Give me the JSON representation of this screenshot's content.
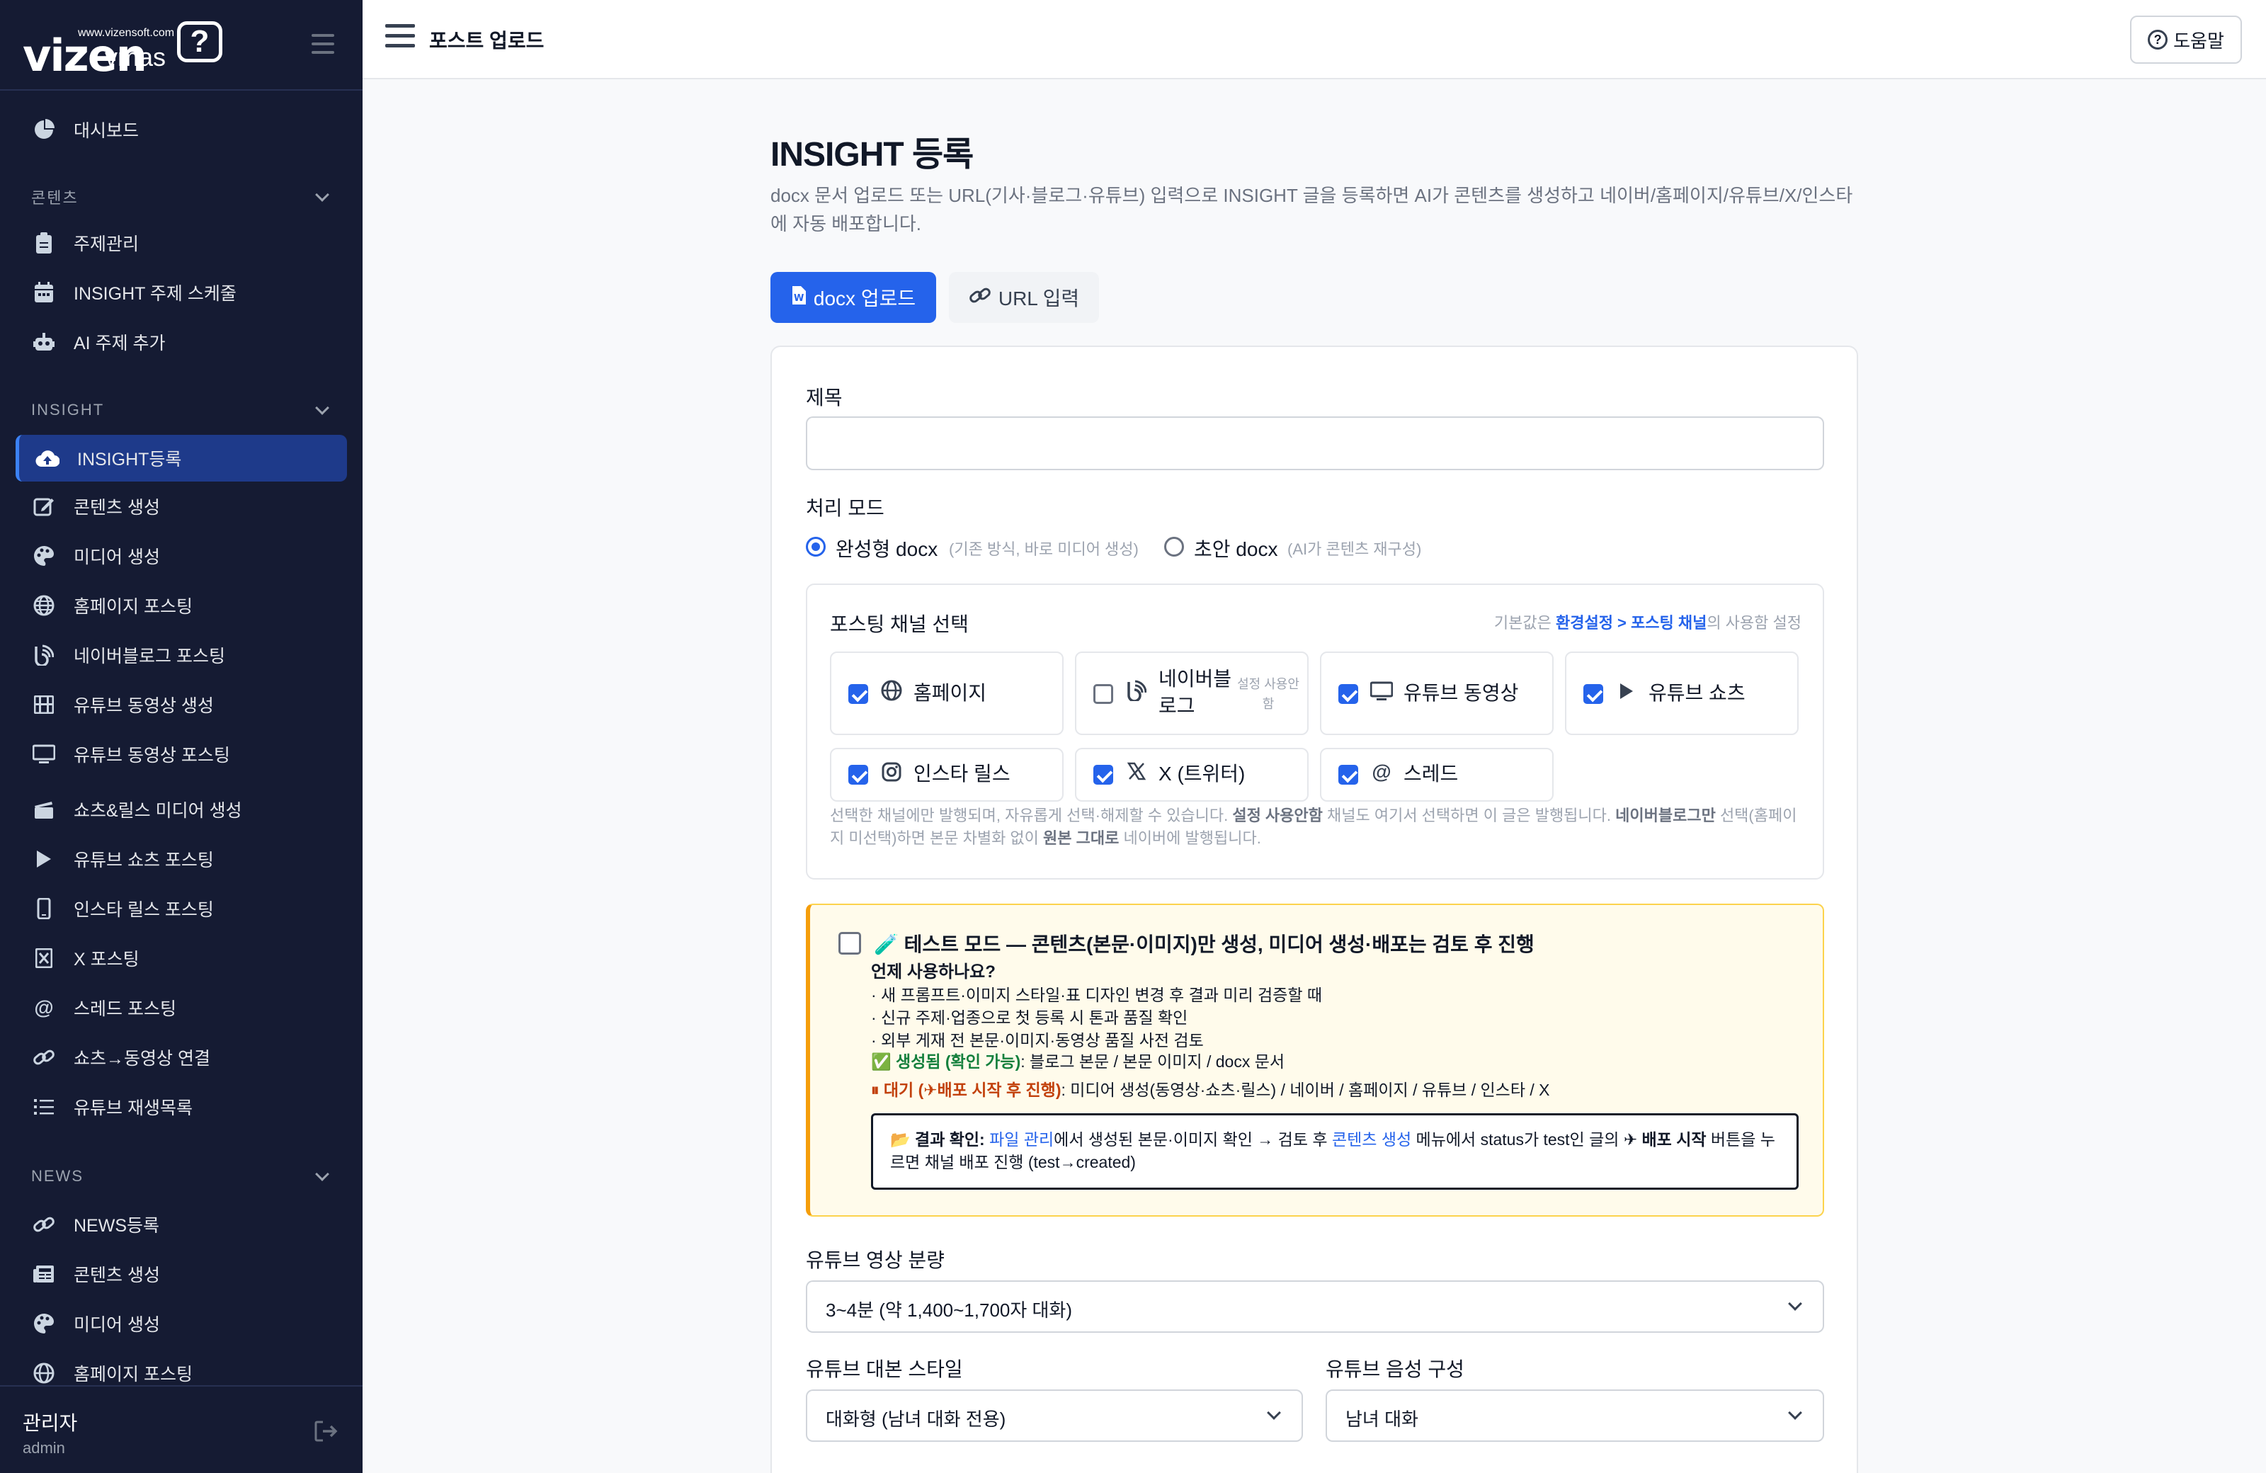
{
  "brand": {
    "logo": "vizen",
    "logo_sub": "vmas",
    "logo_url": "www.vizensoft.com",
    "logo_mark": "?"
  },
  "sidebar": {
    "dashboard": "대시보드",
    "sections": {
      "content": "콘텐츠",
      "insight": "INSIGHT",
      "news": "NEWS"
    },
    "content_items": [
      "주제관리",
      "INSIGHT 주제 스케줄",
      "AI 주제 추가"
    ],
    "insight_items": [
      "INSIGHT등록",
      "콘텐츠 생성",
      "미디어 생성",
      "홈페이지 포스팅",
      "네이버블로그 포스팅",
      "유튜브 동영상 생성",
      "유튜브 동영상 포스팅",
      "쇼츠&릴스 미디어 생성",
      "유튜브 쇼츠 포스팅",
      "인스타 릴스 포스팅",
      "X 포스팅",
      "스레드 포스팅",
      "쇼츠→동영상 연결",
      "유튜브 재생목록"
    ],
    "news_items": [
      "NEWS등록",
      "콘텐츠 생성",
      "미디어 생성",
      "홈페이지 포스팅"
    ],
    "user": {
      "name": "관리자",
      "id": "admin"
    }
  },
  "topbar": {
    "title": "포스트 업로드",
    "help": "도움말"
  },
  "main": {
    "title": "INSIGHT 등록",
    "description": "docx 문서 업로드 또는 URL(기사·블로그·유튜브) 입력으로 INSIGHT 글을 등록하면 AI가 콘텐츠를 생성하고 네이버/홈페이지/유튜브/X/인스타에 자동 배포합니다.",
    "tabs": {
      "docx": "docx 업로드",
      "url": "URL 입력"
    },
    "form": {
      "title_label": "제목",
      "title_value": "",
      "mode_label": "처리 모드",
      "mode_complete": "완성형 docx",
      "mode_complete_hint": "(기존 방식, 바로 미디어 생성)",
      "mode_draft": "초안 docx",
      "mode_draft_hint": "(AI가 콘텐츠 재구성)",
      "channel_title": "포스팅 채널 선택",
      "channel_hint_pre": "기본값은 ",
      "channel_hint_link": "환경설정 > 포스팅 채널",
      "channel_hint_post": "의 사용함 설정",
      "channels": [
        {
          "name": "홈페이지",
          "checked": true,
          "icon": "globe-icon"
        },
        {
          "name": "네이버블로그",
          "sub": "설정 사용안함",
          "checked": false,
          "icon": "blog-icon"
        },
        {
          "name": "유튜브 동영상",
          "checked": true,
          "icon": "monitor-icon"
        },
        {
          "name": "유튜브 쇼츠",
          "checked": true,
          "icon": "play-icon"
        },
        {
          "name": "인스타 릴스",
          "checked": true,
          "icon": "instagram-icon"
        },
        {
          "name": "X (트위터)",
          "checked": true,
          "icon": "x-icon"
        },
        {
          "name": "스레드",
          "checked": true,
          "icon": "threads-icon"
        }
      ],
      "channel_note": {
        "p1": "선택한 채널에만 발행되며, 자유롭게 선택·해제할 수 있습니다. ",
        "b1": "설정 사용안함",
        "p2": " 채널도 여기서 선택하면 이 글은 발행됩니다. ",
        "b2": "네이버블로그만",
        "p3": " 선택(홈페이지 미선택)하면 본문 차별화 없이 ",
        "b3": "원본 그대로",
        "p4": " 네이버에 발행됩니다."
      },
      "test_mode": {
        "title": "🧪 테스트 모드 — 콘텐츠(본문·이미지)만 생성, 미디어 생성·배포는 검토 후 진행",
        "when": "언제 사용하나요?",
        "items": [
          "· 새 프롬프트·이미지 스타일·표 디자인 변경 후 결과 미리 검증할 때",
          "· 신규 주제·업종으로 첫 등록 시 톤과 품질 확인",
          "· 외부 게재 전 본문·이미지·동영상 품질 사전 검토"
        ],
        "ok_label": "✅ 생성됨 (확인 가능)",
        "ok_text": ": 블로그 본문 / 본문 이미지 / docx 문서",
        "wait_label": "⏸ 대기 (✈배포 시작 후 진행)",
        "wait_text": ": 미디어 생성(동영상·쇼츠·릴스) / 네이버 / 홈페이지 / 유튜브 / 인스타 / X",
        "result": {
          "icon": "📂 ",
          "label": "결과 확인:",
          "s1": " ",
          "link1": "파일 관리",
          "s2": "에서 생성된 본문·이미지 확인 → 검토 후 ",
          "link2": "콘텐츠 생성",
          "s3": " 메뉴에서 status가 test인 글의 ",
          "bold": "✈ 배포 시작",
          "s4": " 버튼을 누르면 채널 배포 진행 (test→created)"
        }
      },
      "yt_length_label": "유튜브 영상 분량",
      "yt_length_value": "3~4분 (약 1,400~1,700자 대화)",
      "yt_style_label": "유튜브 대본 스타일",
      "yt_style_value": "대화형 (남녀 대화 전용)",
      "yt_voice_label": "유튜브 음성 구성",
      "yt_voice_value": "남녀 대화"
    }
  }
}
